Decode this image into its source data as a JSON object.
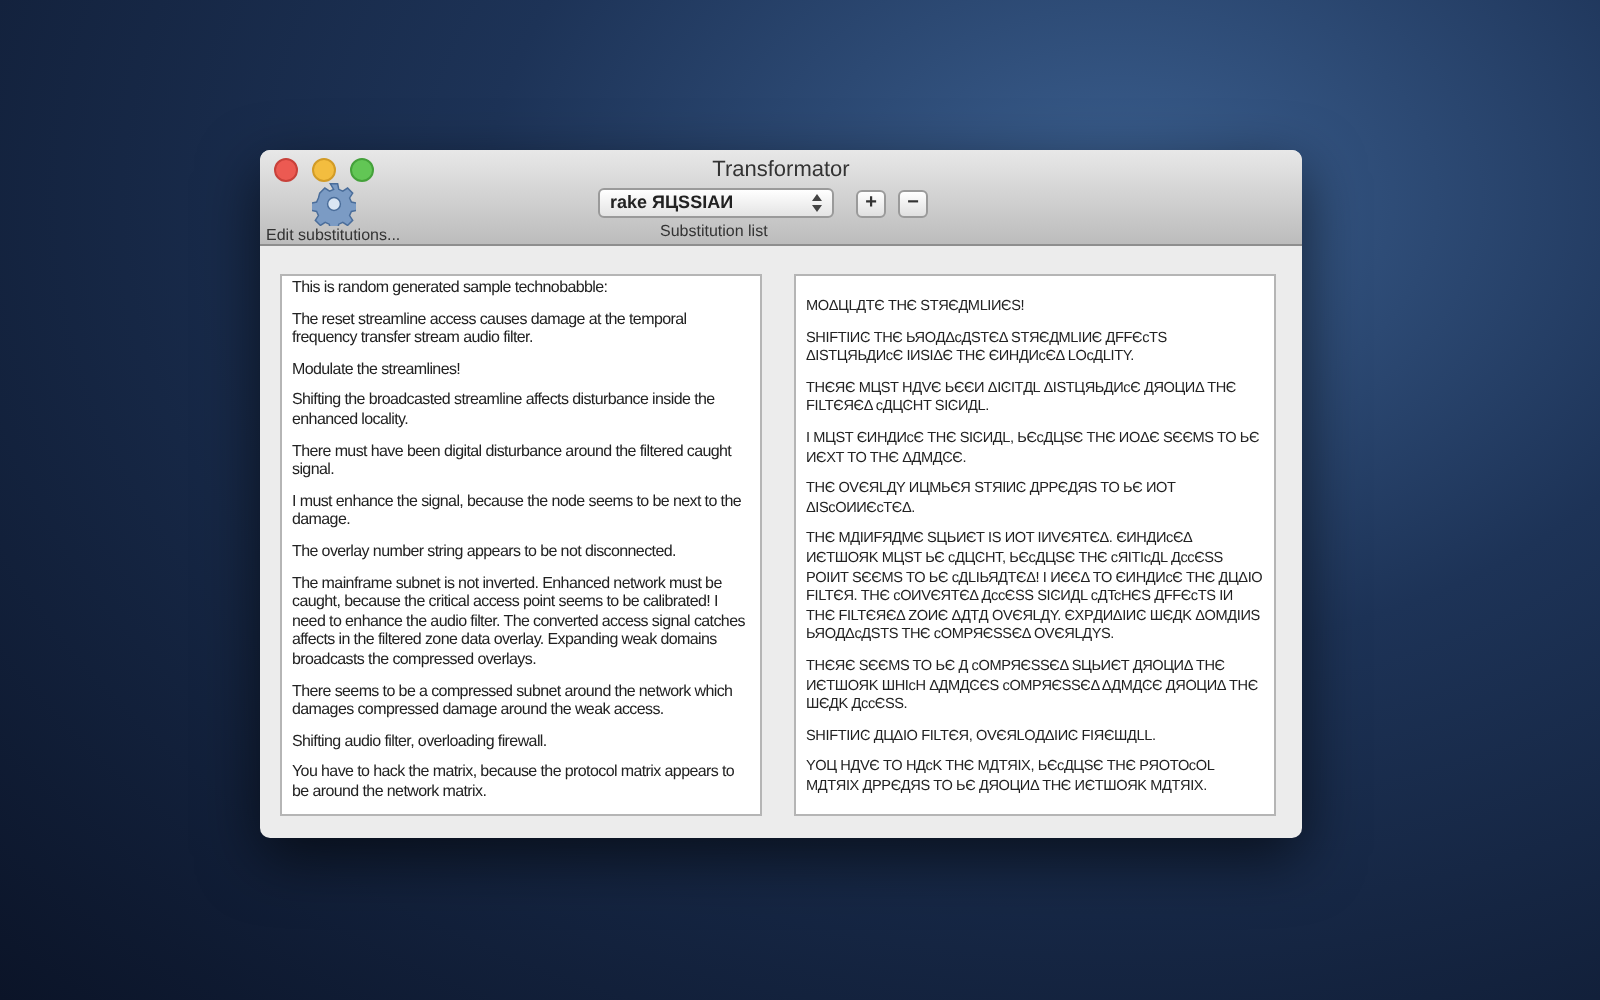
{
  "window": {
    "title": "Transformator"
  },
  "toolbar": {
    "edit_button": {
      "label": "Edit substitutions..."
    },
    "substitution_list": {
      "value": "rake ЯЦSSIAИ",
      "label": "Substitution list"
    },
    "add_button": {
      "label": "+"
    },
    "remove_button": {
      "label": "−"
    }
  },
  "input_text": [
    "This is random generated sample technobabble:",
    "The reset streamline access causes damage at the temporal frequency transfer stream audio filter.",
    "Modulate the streamlines!",
    "Shifting the broadcasted streamline affects disturbance inside the enhanced locality.",
    "There must have been digital disturbance around the filtered caught signal.",
    "I must enhance the signal, because the node seems to be next to the damage.",
    "The overlay number string appears to be not disconnected.",
    "The mainframe subnet is not inverted. Enhanced network must be caught, because the critical access point seems to be calibrated! I need to enhance the audio filter. The converted access signal catches affects in the filtered zone data overlay. Expanding weak domains broadcasts the compressed overlays.",
    "There seems to be a compressed subnet around the network which damages compressed damage around the weak access.",
    "Shifting audio filter, overloading firewall.",
    "You have to hack the matrix, because the protocol matrix appears to be around the network matrix."
  ],
  "output_text": [
    "MOΔЦLДTЄ THЄ STЯЄДMLIИЄS!",
    "SHIFTIИϾ THЄ ЬЯOДΔcДSTЄΔ STЯЄДMLIИЄ ДFFЄcTS ΔISTЦЯЬДИcЄ IИSIΔЄ THЄ ЄИHДИcЄΔ LOcДLITY.",
    "THЄЯЄ MЦST HДVЄ ЬЄЄИ ΔIϾITДL ΔISTЦЯЬДИcЄ ДЯOЦИΔ THЄ FILTЄЯЄΔ cДЦϾHT SIϾИДL.",
    "I MЦST ЄИHДИcЄ THЄ SIϾИДL, ЬЄcДЦSЄ THЄ ИOΔЄ SЄЄMS TO ЬЄ ИЄXT TO THЄ ΔДMДϾЄ.",
    "THЄ OVЄЯLДY ИЦMЬЄЯ STЯIИϾ ДPPЄДЯS TO ЬЄ ИOT ΔIScOИИЄcTЄΔ.",
    "THЄ MДIИFЯДMЄ SЦЬИЄT IS ИOT IИVЄЯTЄΔ. ЄИHДИcЄΔ ИЄTШOЯK MЦST ЬЄ cДЦϾHT, ЬЄcДЦSЄ THЄ cЯITIcДL ДccЄSS POIИT SЄЄMS TO ЬЄ cДLIЬЯДTЄΔ! I ИЄЄΔ TO ЄИHДИcЄ THЄ ДЦΔIO FILTЄЯ. THЄ cOИVЄЯTЄΔ ДccЄSS SIϾИДL cДTcHЄS ДFFЄcTS IИ THЄ FILTЄЯЄΔ ZOИЄ ΔДTД OVЄЯLДY. ЄXPДИΔIИϾ ШЄДK ΔOMДIИS ЬЯOДΔcДSTS THЄ cOMPЯЄSSЄΔ OVЄЯLДYS.",
    "THЄЯЄ SЄЄMS TO ЬЄ Д cOMPЯЄSSЄΔ SЦЬИЄT ДЯOЦИΔ THЄ ИЄTШOЯK ШHIcH ΔДMДϾЄS cOMPЯЄSSЄΔ ΔДMДϾЄ ДЯOЦИΔ THЄ ШЄДK ДccЄSS.",
    "SHIFTIИϾ ДЦΔIO FILTЄЯ, OVЄЯLOДΔIИϾ FIЯЄШДLL.",
    "YOЦ HДVЄ TO HДcK THЄ MДTЯIX, ЬЄcДЦSЄ THЄ PЯOTOcOL MДTЯIX ДPPЄДЯS TO ЬЄ ДЯOЦИΔ THЄ ИЄTШOЯK MДTЯIX."
  ]
}
